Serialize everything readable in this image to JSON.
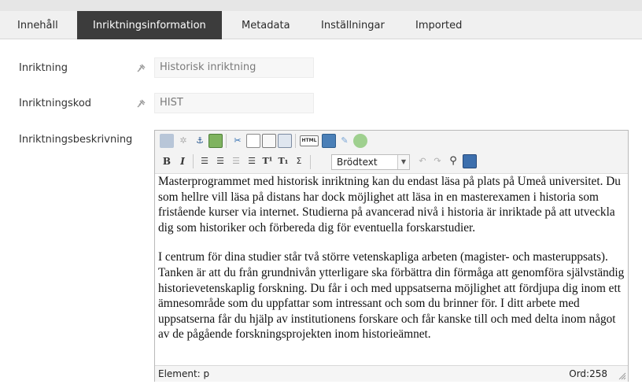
{
  "tabs": [
    {
      "label": "Innehåll",
      "active": false
    },
    {
      "label": "Inriktningsinformation",
      "active": true
    },
    {
      "label": "Metadata",
      "active": false
    },
    {
      "label": "Inställningar",
      "active": false
    },
    {
      "label": "Imported",
      "active": false
    }
  ],
  "form": {
    "inriktning": {
      "label": "Inriktning",
      "value": "Historisk inriktning"
    },
    "inriktningskod": {
      "label": "Inriktningskod",
      "value": "HIST"
    },
    "beskrivning": {
      "label": "Inriktningsbeskrivning"
    }
  },
  "editor": {
    "toolbar": {
      "row1_icons": [
        "spellcheck-icon",
        "unlink-icon",
        "anchor-icon",
        "image-icon",
        "cut-icon",
        "copy-icon",
        "paste-icon",
        "paste-word-icon",
        "html-icon",
        "insert-media-icon",
        "edit-icon",
        "cleanup-icon"
      ],
      "row2_icons": [
        "bold-icon",
        "italic-icon",
        "bullet-list-icon",
        "numbered-list-icon",
        "outdent-icon",
        "indent-icon",
        "superscript-icon",
        "subscript-icon",
        "sigma-icon",
        "undo-icon",
        "redo-icon",
        "search-icon",
        "fullscreen-icon"
      ],
      "bold": "B",
      "italic": "I",
      "html": "HTML",
      "format_select": "Brödtext"
    },
    "paragraphs": [
      "Masterprogrammet med historisk inriktning kan du endast läsa på plats på Umeå universitet. Du som hellre vill läsa på distans har dock möjlighet att läsa in en masterexamen i historia som fristående kurser via internet. Studierna på avancerad nivå i historia är inriktade på att utveckla dig som historiker och förbereda dig för eventuella forskarstudier.",
      "I centrum för dina studier står två större vetenskapliga arbeten (magister- och masteruppsats). Tanken är att du från grundnivån ytterligare ska förbättra din förmåga att genomföra självständig historievetenskaplig forskning. Du får i och med uppsatserna möjlighet att fördjupa dig inom ett ämnesområde som du uppfattar som intressant och som du brinner för. I ditt arbete med uppsatserna får du hjälp av institutionens forskare och får kanske till och med delta inom något av de pågående forskningsprojekten inom historieämnet."
    ],
    "status": {
      "element": "Element: p",
      "wordcount": "Ord:258"
    }
  },
  "colors": {
    "active_tab_bg": "#3c3c3c",
    "tab_bar_bg": "#f0f0f0",
    "field_bg": "#f7f7f7"
  }
}
